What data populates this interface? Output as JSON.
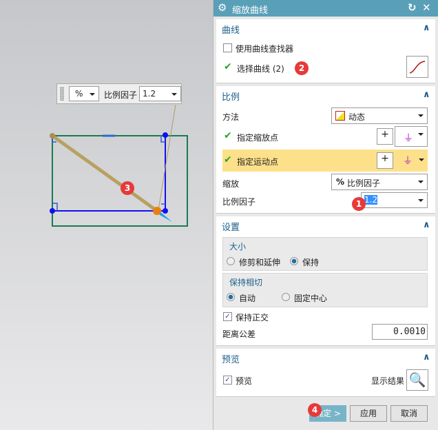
{
  "viewport": {
    "toolbar": {
      "unit": "%",
      "label": "比例因子",
      "value": "1.2"
    },
    "badge": "3"
  },
  "dialog": {
    "title": "缩放曲线",
    "curve": {
      "header": "曲线",
      "use_finder": "使用曲线查找器",
      "use_finder_checked": false,
      "select": "选择曲线 (2)",
      "badge": "2"
    },
    "scale": {
      "header": "比例",
      "method_label": "方法",
      "method_value": "动态",
      "scale_point": "指定缩放点",
      "motion_point": "指定运动点",
      "scale_label": "缩放",
      "scale_value": "比例因子",
      "scale_unit": "%",
      "factor_label": "比例因子",
      "factor_value": "1.2",
      "badge": "1"
    },
    "settings": {
      "header": "设置",
      "size_group": "大小",
      "trim": "修剪和延伸",
      "keep": "保持",
      "size_selected": "保持",
      "tangent_group": "保持相切",
      "auto": "自动",
      "fixed_center": "固定中心",
      "tangent_selected": "自动",
      "keep_ortho": "保持正交",
      "keep_ortho_checked": true,
      "tolerance_label": "距离公差",
      "tolerance_value": "0.0010"
    },
    "preview": {
      "header": "预览",
      "preview": "预览",
      "preview_checked": true,
      "show_result": "显示结果"
    },
    "buttons": {
      "ok": "确定 >",
      "apply": "应用",
      "cancel": "取消",
      "badge": "4"
    }
  }
}
